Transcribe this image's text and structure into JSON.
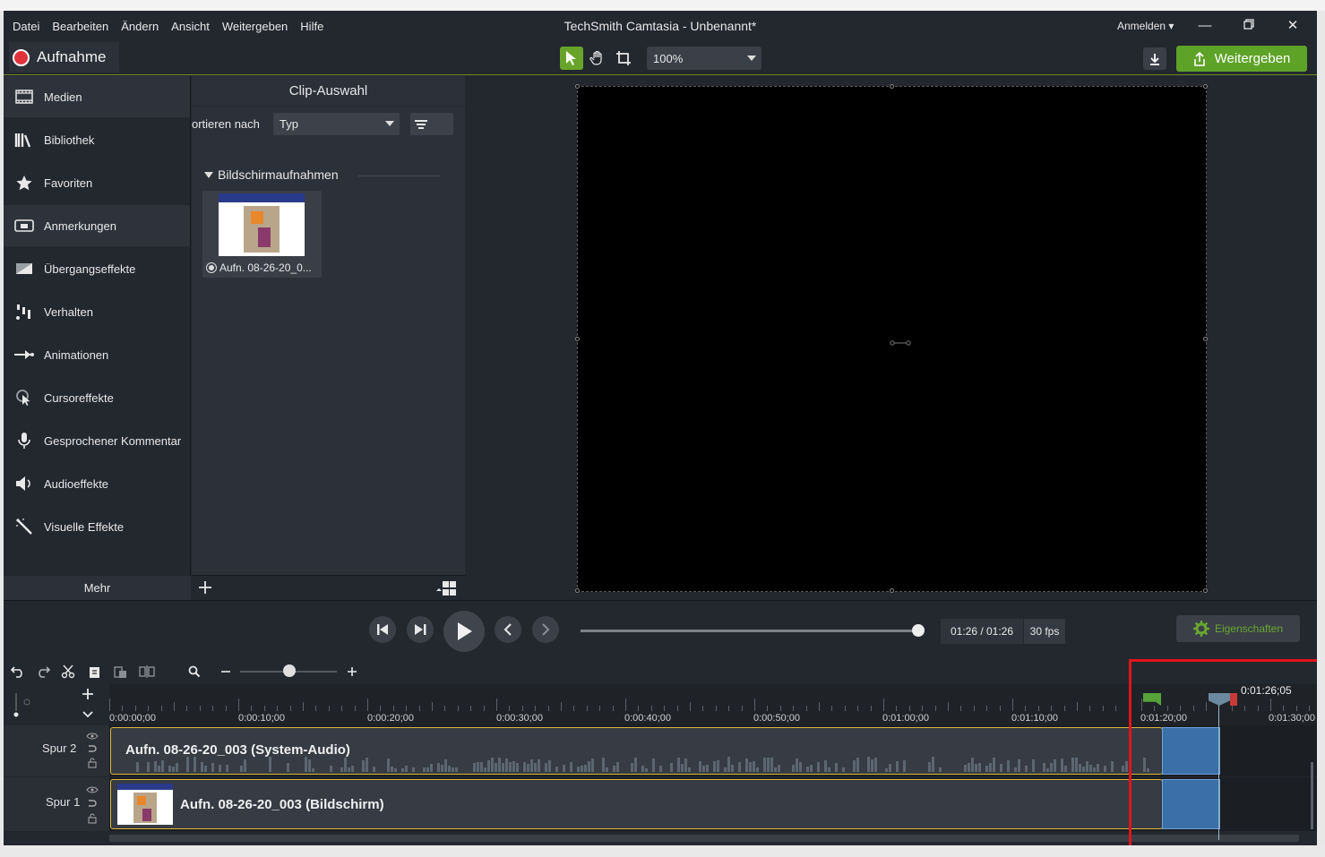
{
  "menubar": {
    "items": [
      "Datei",
      "Bearbeiten",
      "Ändern",
      "Ansicht",
      "Weitergeben",
      "Hilfe"
    ],
    "title": "TechSmith Camtasia - Unbenannt*",
    "signin": "Anmelden ▾"
  },
  "toolbar": {
    "record_label": "Aufnahme",
    "zoom_value": "100%",
    "share_label": "Weitergeben"
  },
  "leftnav": {
    "items": [
      {
        "label": "Medien",
        "icon": "film-icon"
      },
      {
        "label": "Bibliothek",
        "icon": "library-icon"
      },
      {
        "label": "Favoriten",
        "icon": "star-icon"
      },
      {
        "label": "Anmerkungen",
        "icon": "annotation-icon"
      },
      {
        "label": "Übergangseffekte",
        "icon": "transition-icon"
      },
      {
        "label": "Verhalten",
        "icon": "behavior-icon"
      },
      {
        "label": "Animationen",
        "icon": "animation-icon"
      },
      {
        "label": "Cursoreffekte",
        "icon": "cursor-icon"
      },
      {
        "label": "Gesprochener Kommentar",
        "icon": "microphone-icon"
      },
      {
        "label": "Audioeffekte",
        "icon": "speaker-icon"
      },
      {
        "label": "Visuelle Effekte",
        "icon": "wand-icon"
      }
    ],
    "more_label": "Mehr"
  },
  "clip_panel": {
    "title": "Clip-Auswahl",
    "sort_label": "ortieren nach",
    "sort_value": "Typ",
    "section_label": "Bildschirmaufnahmen",
    "clip_name": "Aufn. 08-26-20_0..."
  },
  "playback": {
    "progress": 1.0,
    "time": "01:26 / 01:26",
    "fps": "30 fps",
    "properties_label": "Eigenschaften"
  },
  "timeline": {
    "ruler_labels": [
      "0:00:00;00",
      "0:00:10;00",
      "0:00:20;00",
      "0:00:30;00",
      "0:00:40;00",
      "0:00:50;00",
      "0:01:00;00",
      "0:01:10;00",
      "0:01:20;00",
      "0:01:30;00"
    ],
    "playhead_time": "0:01:26;05",
    "tracks": [
      {
        "name": "Spur 2",
        "clip": "Aufn. 08-26-20_003 (System-Audio)"
      },
      {
        "name": "Spur 1",
        "clip": "Aufn. 08-26-20_003 (Bildschirm)"
      }
    ]
  },
  "colors": {
    "accent_green": "#5ea328",
    "selection_blue": "#3b6fa8",
    "highlight_red": "#e0141c",
    "clip_border": "#d9b83a"
  }
}
